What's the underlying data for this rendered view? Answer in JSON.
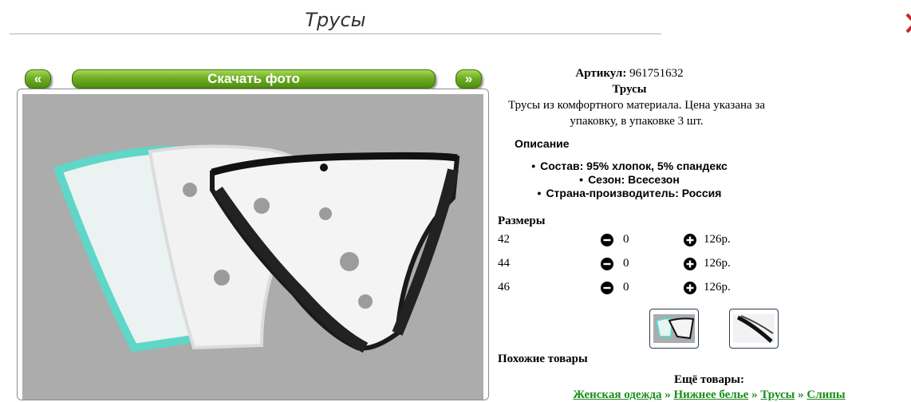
{
  "page": {
    "title": "Трусы"
  },
  "nav": {
    "prev_label": "«",
    "download_label": "Скачать фото",
    "next_label": "»"
  },
  "product": {
    "article_label": "Артикул:",
    "article_value": "961751632",
    "name": "Трусы",
    "description": "Трусы из комфортного материала. Цена указана за упаковку, в упаковке 3 шт.",
    "specs_heading": "Описание",
    "specs": [
      "Состав: 95% хлопок, 5% спандекс",
      "Сезон: Всесезон",
      "Страна-производитель: Россия"
    ]
  },
  "sizes": {
    "heading": "Размеры",
    "rows": [
      {
        "size": "42",
        "qty": "0",
        "price": "126р."
      },
      {
        "size": "44",
        "qty": "0",
        "price": "126р."
      },
      {
        "size": "46",
        "qty": "0",
        "price": "126р."
      }
    ]
  },
  "similar": {
    "heading": "Похожие товары"
  },
  "more": {
    "heading": "Ещё товары:",
    "breadcrumbs": [
      "Женская одежда",
      "Нижнее белье",
      "Трусы",
      "Слипы"
    ],
    "separator": "»"
  },
  "icons": {
    "minus": "minus-circle-icon",
    "plus": "plus-circle-icon",
    "close": "close-icon"
  },
  "colors": {
    "button_green": "#6fae21",
    "link_green": "#1a8c1a",
    "photo_bg": "#acacac"
  }
}
